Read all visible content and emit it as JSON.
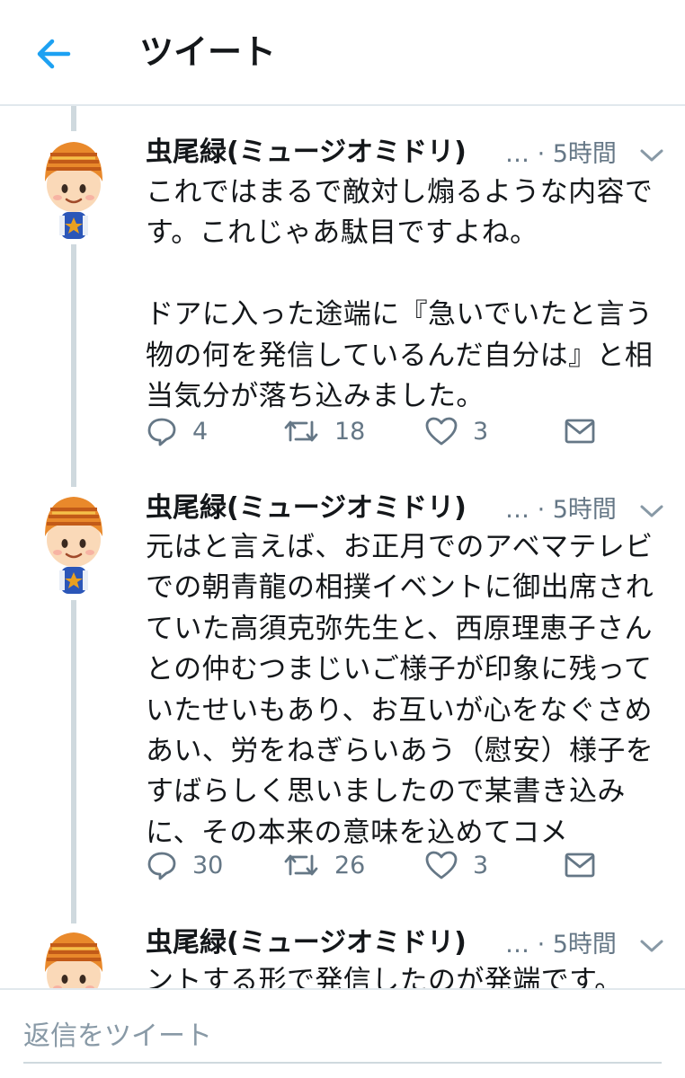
{
  "header": {
    "title": "ツイート",
    "back_icon": "arrow-left-icon",
    "accent": "#1da1f2"
  },
  "tweets": [
    {
      "name": "虫尾緑(ミュージオミドリ)",
      "meta": "… · 5時間",
      "text": "これではまるで敵対し煽るような内容です。これじゃあ駄目ですよね。\n\nドアに入った途端に『急いでいたと言う物の何を発信しているんだ自分は』と相当気分が落ち込みました。",
      "replies": "4",
      "retweets": "18",
      "likes": "3"
    },
    {
      "name": "虫尾緑(ミュージオミドリ)",
      "meta": "… · 5時間",
      "text": "元はと言えば、お正月でのアベマテレビでの朝青龍の相撲イベントに御出席されていた高須克弥先生と、西原理恵子さんとの仲むつまじいご様子が印象に残っていたせいもあり、お互いが心をなぐさめあい、労をねぎらいあう（慰安）様子をすばらしく思いましたので某書き込みに、その本来の意味を込めてコメ",
      "replies": "30",
      "retweets": "26",
      "likes": "3"
    },
    {
      "name": "虫尾緑(ミュージオミドリ)",
      "meta": "… · 5時間",
      "text": "ントする形で発信したのが発端です。"
    }
  ],
  "reply_bar": {
    "placeholder": "返信をツイート"
  }
}
